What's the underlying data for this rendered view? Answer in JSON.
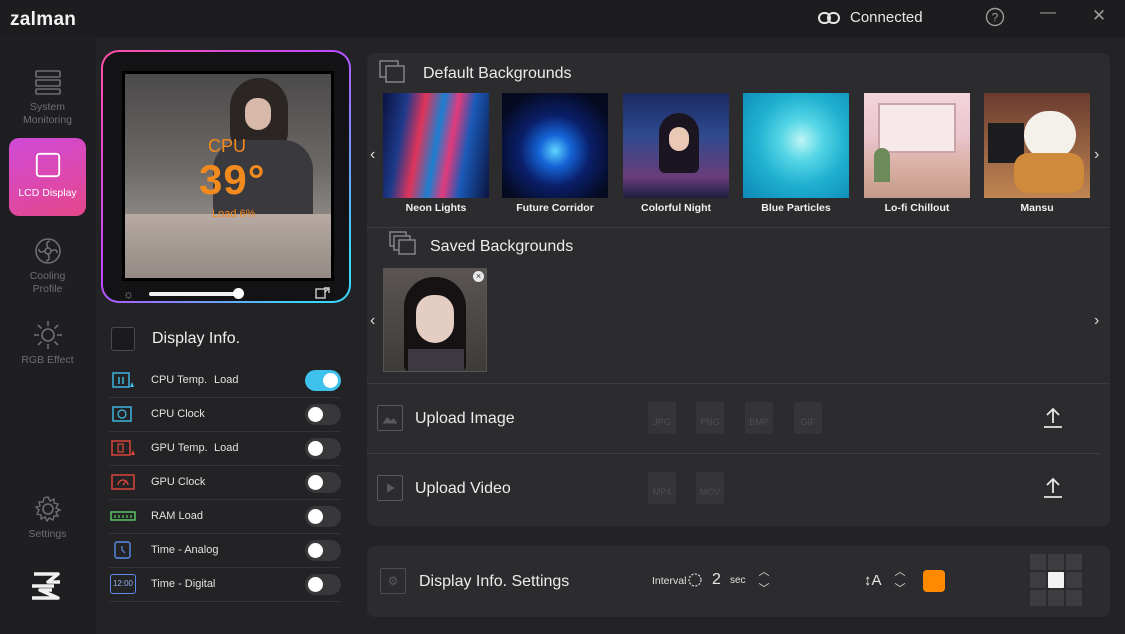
{
  "app": {
    "logo": "zalman"
  },
  "titlebar": {
    "status": "Connected",
    "help": "?",
    "minimize": "—",
    "close": "✕"
  },
  "sidebar": {
    "items": [
      {
        "label": "System\nMonitoring",
        "icon": "monitoring-icon",
        "active": false
      },
      {
        "label": "LCD Display",
        "icon": "lcd-icon",
        "active": true
      },
      {
        "label": "Cooling\nProfile",
        "icon": "fan-icon",
        "active": false
      },
      {
        "label": "RGB Effect",
        "icon": "sun-icon",
        "active": false
      }
    ],
    "settings_label": "Settings"
  },
  "preview": {
    "label": "CPU",
    "temp": "39°",
    "load": "Load  6%",
    "brightness": 0.9
  },
  "display_info": {
    "title": "Display Info.",
    "rows": [
      {
        "label": "CPU Temp.",
        "extra": "Load",
        "on": true,
        "icon": "cpu-temp-icon"
      },
      {
        "label": "CPU Clock",
        "extra": "",
        "on": false,
        "icon": "cpu-clock-icon"
      },
      {
        "label": "GPU Temp.",
        "extra": "Load",
        "on": false,
        "icon": "gpu-temp-icon"
      },
      {
        "label": "GPU Clock",
        "extra": "",
        "on": false,
        "icon": "gpu-clock-icon"
      },
      {
        "label": "RAM Load",
        "extra": "",
        "on": false,
        "icon": "ram-icon"
      },
      {
        "label": "Time - Analog",
        "extra": "",
        "on": false,
        "icon": "clock-analog-icon"
      },
      {
        "label": "Time - Digital",
        "extra": "",
        "on": false,
        "icon": "clock-digital-icon",
        "icon_text": "12:00"
      }
    ]
  },
  "backgrounds": {
    "default_title": "Default Backgrounds",
    "items": [
      {
        "name": "Neon Lights"
      },
      {
        "name": "Future Corridor"
      },
      {
        "name": "Colorful Night"
      },
      {
        "name": "Blue Particles"
      },
      {
        "name": "Lo-fi Chillout"
      },
      {
        "name": "Mansu"
      }
    ],
    "saved_title": "Saved Backgrounds",
    "prev": "‹",
    "next": "›"
  },
  "upload": {
    "image_title": "Upload Image",
    "image_formats": [
      "JPG",
      "PNG",
      "BMP",
      "GIF"
    ],
    "video_title": "Upload Video",
    "video_formats": [
      "MP4",
      "MOV"
    ]
  },
  "settings": {
    "title": "Display Info. Settings",
    "interval_label": "Interval",
    "interval_value": "2",
    "interval_unit": "sec",
    "font_size_label": "↕A",
    "color": "#ff8a00"
  }
}
